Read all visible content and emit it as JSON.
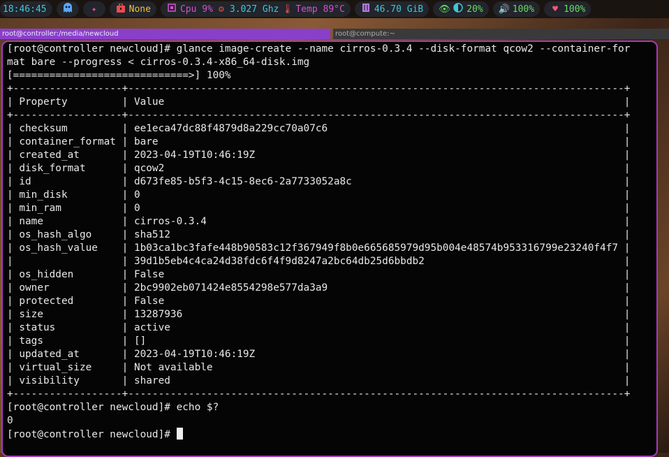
{
  "statusbar": {
    "time": "18:46:45",
    "ghost_icon": "ghost-icon",
    "sparkle_icon": "sparkle-icon",
    "package": "None",
    "cpu": "Cpu 9%",
    "cpu_freq": "3.027 Ghz",
    "temp": "Temp 89°C",
    "memory": "46.70 GiB",
    "privacy": "20%",
    "volume": "100%",
    "battery": "100%",
    "colors": {
      "time": "#41c7d9",
      "ghost": "#58a8ff",
      "sparkle": "#e74c8c",
      "package": "#f0c040",
      "cpu": "#d94fd0",
      "freq": "#41c7d9",
      "temp": "#d94fd0",
      "memory": "#41c7d9",
      "eye": "#66dd66",
      "privacy": "#66dd66",
      "volume": "#ff5577",
      "battery": "#66dd66",
      "heart": "#ff5577"
    }
  },
  "tabs": [
    {
      "title": "root@controller:/media/newcloud"
    },
    {
      "title": "root@compute:~"
    }
  ],
  "terminal": {
    "lines": [
      "[root@controller newcloud]# glance image-create --name cirros-0.3.4 --disk-format qcow2 --container-for",
      "mat bare --progress < cirros-0.3.4-x86_64-disk.img",
      "[=============================>] 100%",
      "+------------------+----------------------------------------------------------------------------------+",
      "| Property         | Value                                                                            |",
      "+------------------+----------------------------------------------------------------------------------+",
      "| checksum         | ee1eca47dc88f4879d8a229cc70a07c6                                                 |",
      "| container_format | bare                                                                             |",
      "| created_at       | 2023-04-19T10:46:19Z                                                             |",
      "| disk_format      | qcow2                                                                            |",
      "| id               | d673fe85-b5f3-4c15-8ec6-2a7733052a8c                                             |",
      "| min_disk         | 0                                                                                |",
      "| min_ram          | 0                                                                                |",
      "| name             | cirros-0.3.4                                                                     |",
      "| os_hash_algo     | sha512                                                                           |",
      "| os_hash_value    | 1b03ca1bc3fafe448b90583c12f367949f8b0e665685979d95b004e48574b953316799e23240f4f7 |",
      "|                  | 39d1b5eb4c4ca24d38fdc6f4f9d8247a2bc64db25d6bbdb2                                 |",
      "| os_hidden        | False                                                                            |",
      "| owner            | 2bc9902eb071424e8554298e577da3a9                                                 |",
      "| protected        | False                                                                            |",
      "| size             | 13287936                                                                         |",
      "| status           | active                                                                           |",
      "| tags             | []                                                                               |",
      "| updated_at       | 2023-04-19T10:46:19Z                                                             |",
      "| virtual_size     | Not available                                                                    |",
      "| visibility       | shared                                                                           |",
      "+------------------+----------------------------------------------------------------------------------+",
      "[root@controller newcloud]# echo $?",
      "0"
    ],
    "prompt": "[root@controller newcloud]# "
  }
}
